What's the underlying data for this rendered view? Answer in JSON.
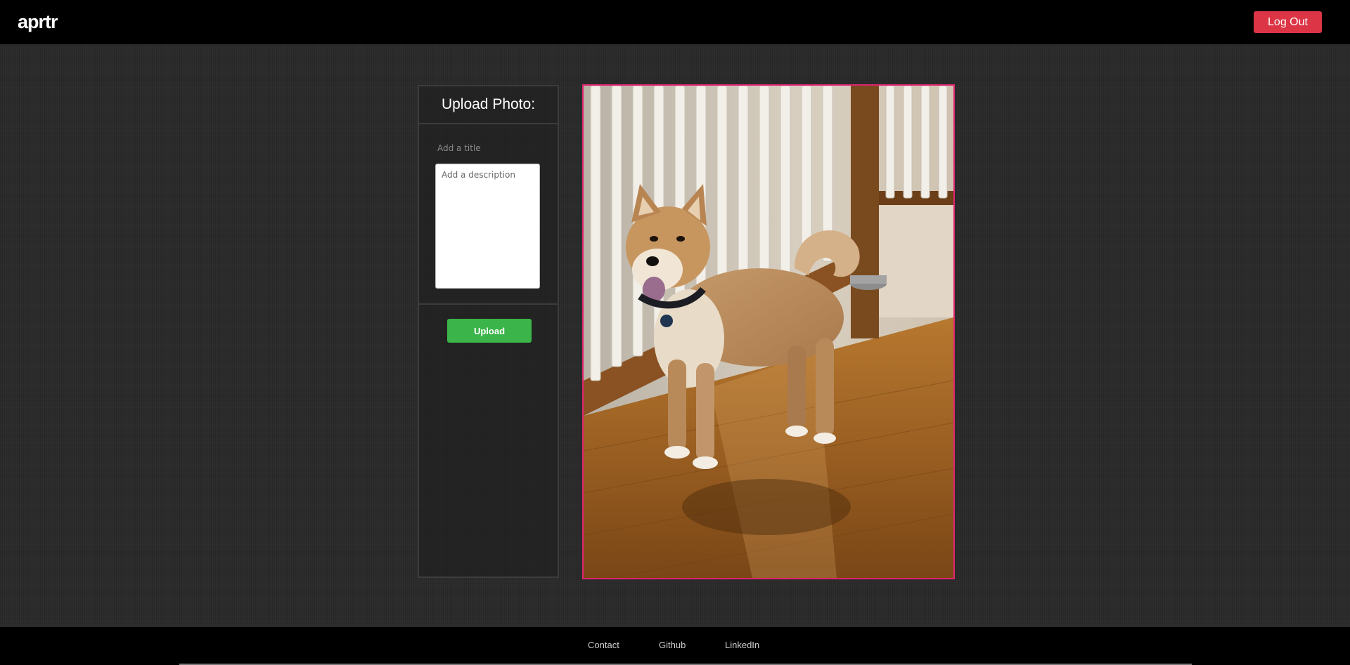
{
  "header": {
    "logo": "aprtr",
    "logout_label": "Log Out"
  },
  "upload_form": {
    "heading": "Upload Photo:",
    "title_placeholder": "Add a title",
    "title_value": "",
    "description_placeholder": "Add a description",
    "description_value": "",
    "upload_label": "Upload"
  },
  "preview": {
    "icon": "photo-preview-image",
    "subject": "dog-photo"
  },
  "footer": {
    "links": [
      "Contact",
      "Github",
      "LinkedIn"
    ]
  },
  "colors": {
    "logout_button": "#dc3545",
    "upload_button": "#3bb54a",
    "preview_border": "#e0246f",
    "header_bg": "#000000",
    "page_bg": "#2b2b2b"
  }
}
